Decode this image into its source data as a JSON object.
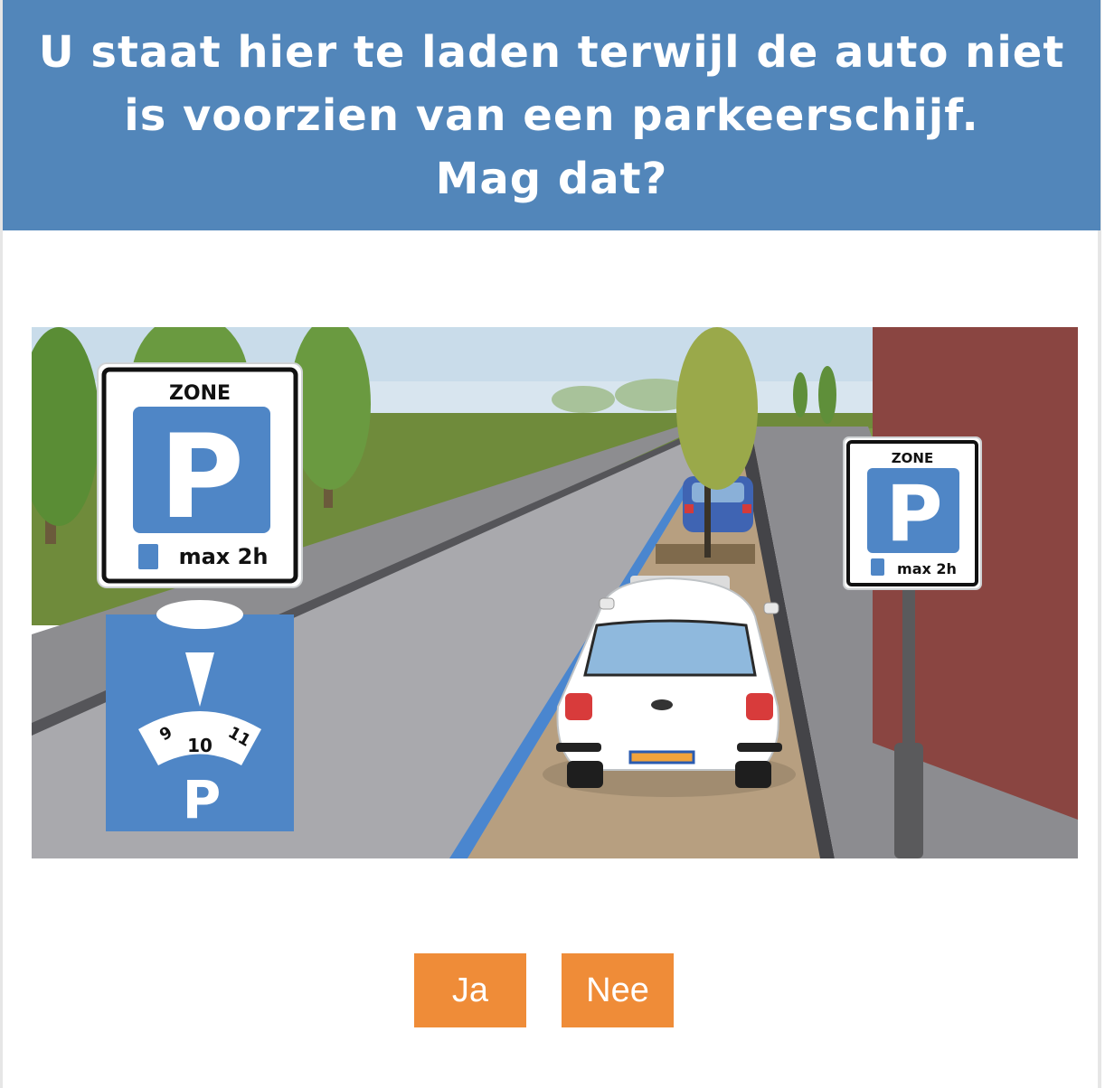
{
  "question": {
    "line1": "U staat hier te laden terwijl de auto niet",
    "line2": "is voorzien van een parkeerschijf.",
    "line3": "Mag dat?"
  },
  "scene": {
    "sign_left": {
      "zone": "ZONE",
      "letter": "P",
      "max": "max 2h"
    },
    "sign_right": {
      "zone": "ZONE",
      "letter": "P",
      "max": "max 2h"
    },
    "disc": {
      "hours": [
        "9",
        "10",
        "11"
      ],
      "letter": "P"
    }
  },
  "answers": {
    "yes": "Ja",
    "no": "Nee"
  },
  "colors": {
    "header": "#5286ba",
    "button": "#ef8c38",
    "sign_blue": "#4f86c6"
  }
}
